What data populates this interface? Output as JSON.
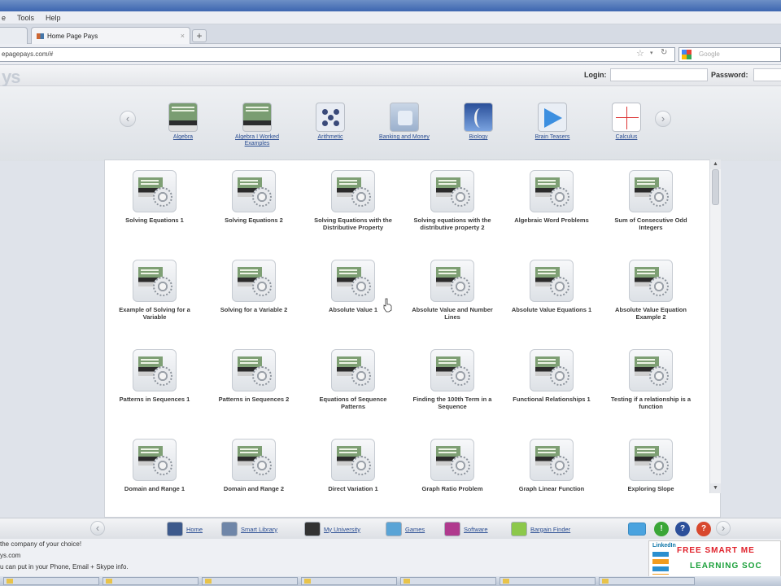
{
  "browser": {
    "menu": [
      "e",
      "Tools",
      "Help"
    ],
    "tab_title": "Home Page Pays",
    "tab_close": "×",
    "new_tab": "+",
    "url": "epagepays.com/#",
    "search_placeholder": "Google"
  },
  "site": {
    "logo": "ys",
    "login_label": "Login:",
    "password_label": "Password:"
  },
  "categories": {
    "prev": "‹",
    "next": "›",
    "items": [
      {
        "label": "Algebra"
      },
      {
        "label": "Algebra I Worked Examples"
      },
      {
        "label": "Arithmetic"
      },
      {
        "label": "Banking and Money"
      },
      {
        "label": "Biology"
      },
      {
        "label": "Brain Teasers"
      },
      {
        "label": "Calculus"
      }
    ]
  },
  "lessons": [
    "Solving Equations 1",
    "Solving Equations 2",
    "Solving Equations with the Distributive Property",
    "Solving equations with the distributive property 2",
    "Algebraic Word Problems",
    "Sum of Consecutive Odd Integers",
    "Example of Solving for a Variable",
    "Solving for a Variable 2",
    "Absolute Value 1",
    "Absolute Value and Number Lines",
    "Absolute Value Equations 1",
    "Absolute Value Equation Example 2",
    "Patterns in Sequences 1",
    "Patterns in Sequences 2",
    "Equations of Sequence Patterns",
    "Finding the 100th Term in a Sequence",
    "Functional Relationships 1",
    "Testing if a relationship is a function",
    "Domain and Range 1",
    "Domain and Range 2",
    "Direct Variation 1",
    "Graph Ratio Problem",
    "Graph Linear Function",
    "Exploring Slope"
  ],
  "bottom_nav": {
    "prev": "‹",
    "next": "›",
    "items": [
      {
        "label": "Home"
      },
      {
        "label": "Smart Library"
      },
      {
        "label": "My University"
      },
      {
        "label": "Games"
      },
      {
        "label": "Software"
      },
      {
        "label": "Bargain Finder"
      }
    ],
    "status_icons": [
      "?",
      "?"
    ]
  },
  "status": {
    "line1": "the company of your choice!",
    "line2": "ys.com",
    "line3": "u can put in your Phone, Email + Skype info."
  },
  "ad": {
    "brand": "LinkedIn",
    "line1": "FREE SMART ME",
    "line2": "LEARNING SOC"
  },
  "colors": {
    "link": "#2a4d92",
    "accent_red": "#e0202a",
    "accent_green": "#1aa03a"
  }
}
